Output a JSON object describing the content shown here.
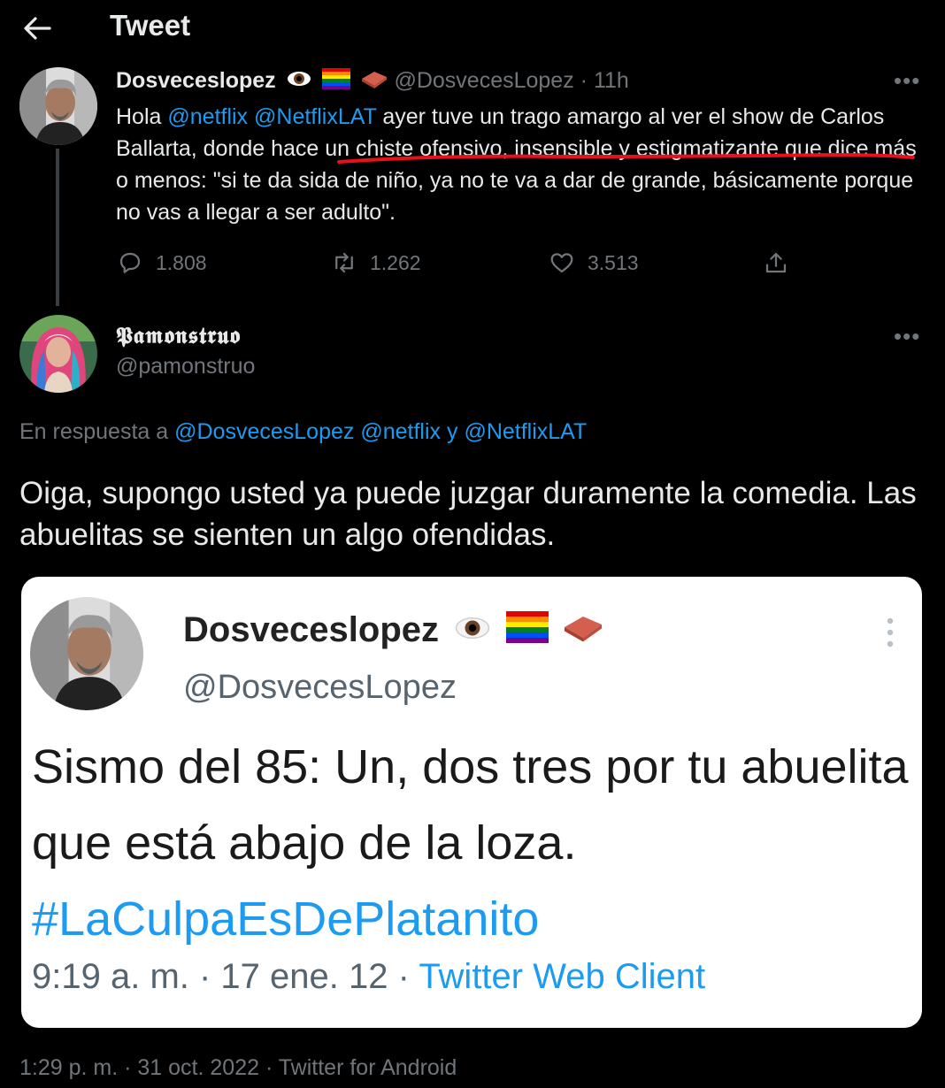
{
  "header": {
    "title": "Tweet",
    "back_icon": "arrow-left-icon"
  },
  "tweet_original": {
    "author_name": "Dosveceslopez",
    "emojis": [
      "eye-emoji",
      "rainbow-flag-emoji",
      "brick-emoji"
    ],
    "handle": "@DosvecesLopez",
    "separator": " · ",
    "time": "11h",
    "text_mention1": "@netflix",
    "text_mention2": "@NetflixLAT",
    "text_lead": "Hola ",
    "text_body": " ayer tuve un trago amargo al ver el show de Carlos Ballarta, donde hace un chiste ofensivo, insensible y estigmatizante que dice más o menos: \"si te da sida de niño, ya no te va a dar de grande, básicamente porque no vas a llegar a ser adulto\".",
    "underline_color": "#e8101c",
    "actions": {
      "replies": "1.808",
      "retweets": "1.262",
      "likes": "3.513"
    }
  },
  "tweet_reply": {
    "author_name": "𝕻𝖆𝖒𝖔𝖓𝖘𝖙𝖗𝖚𝖔",
    "handle": "@pamonstruo",
    "reply_prefix": "En respuesta a ",
    "reply_mention1": "@DosvecesLopez",
    "reply_mention2": "@netflix",
    "reply_and": "y",
    "reply_mention3": "@NetflixLAT",
    "text": "Oiga, supongo usted ya puede juzgar duramente la comedia. Las abuelitas se sienten un algo ofendidas.",
    "timestamp": "1:29 p. m.",
    "date": "31 oct. 2022",
    "client": "Twitter for Android",
    "separator": " · "
  },
  "embedded_card": {
    "author_name": "Dosveceslopez",
    "handle": "@DosvecesLopez",
    "text": "Sismo del 85: Un, dos tres por tu abuelita que está abajo de la loza.",
    "hashtag": "#LaCulpaEsDePlatanito",
    "time": "9:19 a. m.",
    "date": "17 ene. 12",
    "client": "Twitter Web Client",
    "separator": " · "
  },
  "colors": {
    "background": "#000000",
    "accent": "#1d9bf0",
    "muted": "#71767b",
    "text": "#e7e9ea"
  }
}
